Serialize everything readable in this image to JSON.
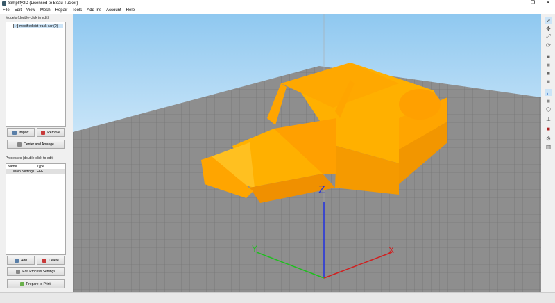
{
  "window": {
    "title": "Simplify3D (Licensed to Beau Tucker)",
    "min": "–",
    "max": "❐",
    "close": "✕"
  },
  "menu": [
    "File",
    "Edit",
    "View",
    "Mesh",
    "Repair",
    "Tools",
    "Add-Ins",
    "Account",
    "Help"
  ],
  "models": {
    "label": "Models (double-click to edit)",
    "items": [
      "modified dirt track car (0)"
    ],
    "import": "Import",
    "remove": "Remove",
    "center": "Center and Arrange"
  },
  "processes": {
    "label": "Processes (double-click to edit)",
    "col_name": "Name",
    "col_type": "Type",
    "rows": [
      {
        "name": "Main Settings",
        "type": "FFF"
      }
    ],
    "add": "Add",
    "delete": "Delete",
    "edit": "Edit Process Settings",
    "prepare": "Prepare to Print!"
  },
  "axes": {
    "x": "X",
    "y": "Y",
    "z": "Z"
  },
  "colors": {
    "model": "#ffa500",
    "floor": "#8a8a8a"
  }
}
